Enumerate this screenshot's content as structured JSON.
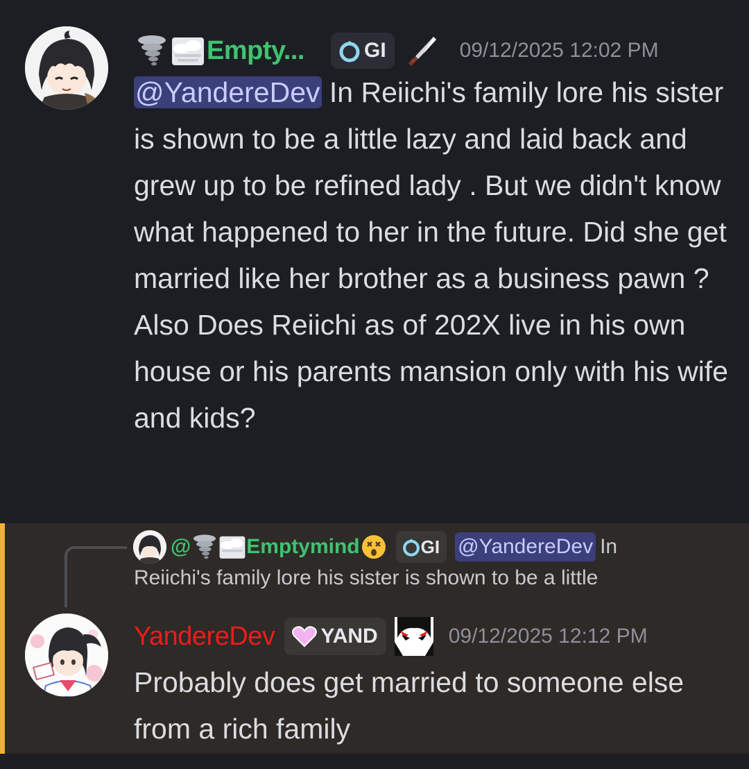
{
  "colors": {
    "background": "#1d1e24",
    "highlight_background": "#2d2a27",
    "highlight_bar": "#f0b232",
    "username_green": "#3ec470",
    "username_red": "#ea1d1d",
    "mention_bg": "#3b3f7a",
    "timestamp": "#8e909a"
  },
  "message1": {
    "username": "Empty...",
    "username_prefix_icons": [
      "tornado-emoji-icon",
      "fog-emoji-icon"
    ],
    "tag": "GI",
    "tag_icon": "ring-icon",
    "badge_icon": "knife-icon",
    "timestamp": "09/12/2025 12:02 PM",
    "mention": "@YandereDev",
    "text_after_mention": " In Reiichi's family lore his sister is shown to be a little lazy and laid back and grew up to be refined lady . But we didn't know what happened to her in the future. Did she get married like her brother as a business pawn ?",
    "text_line2": "Also Does Reiichi as of 202X live in his own house  or his parents mansion only with his wife and kids?"
  },
  "message2": {
    "reply": {
      "username": "@🌪️🌫Emptymind",
      "username_display": "Emptymind",
      "at": "@",
      "suffix_emoji_icon": "dizzy-face-emoji-icon",
      "tag": "GI",
      "mention": "@YandereDev",
      "preview_part1": "In",
      "preview_part2": "Reiichi's family lore his sister is shown to be a little"
    },
    "username": "YandereDev",
    "tag": "YAND",
    "tag_icon": "heart-icon",
    "badge_icon": "yandere-face-icon",
    "timestamp": "09/12/2025 12:12 PM",
    "text": "Probably does get married to someone else from a rich family"
  }
}
